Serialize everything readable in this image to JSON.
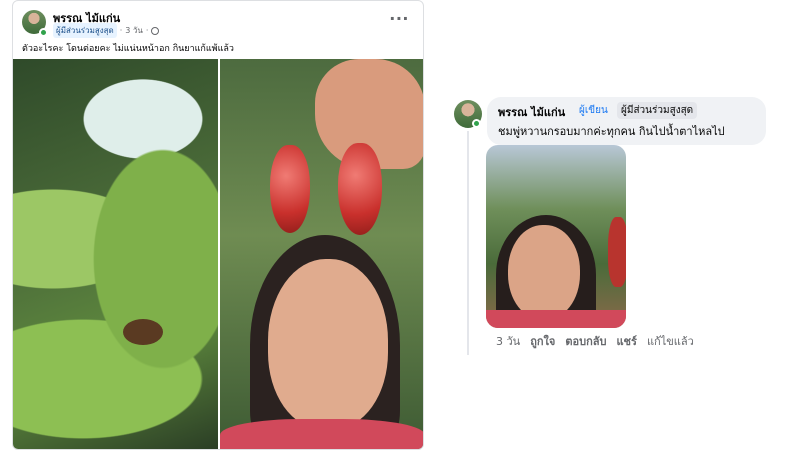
{
  "post": {
    "author": "พรรณ ไม้แก่น",
    "badge": "ผู้มีส่วนร่วมสูงสุด",
    "time": "3 วัน",
    "caption": "ตัวอะไรคะ โดนต่อยคะ ไม่แน่นหน้าอก กินยาแก้แพ้แล้ว"
  },
  "comment": {
    "author": "พรรณ ไม้แก่น",
    "role": "ผู้เขียน",
    "badge": "ผู้มีส่วนร่วมสูงสุด",
    "text": "ชมพู่หวานกรอบมากค่ะทุกคน กินไปน้ำตาไหลไป",
    "actions": {
      "time": "3 วัน",
      "like": "ถูกใจ",
      "reply": "ตอบกลับ",
      "share": "แชร์",
      "edited": "แก้ไขแล้ว"
    }
  },
  "colors": {
    "link_blue": "#1877f2",
    "online_green": "#31a24c",
    "bubble_bg": "#f0f2f5"
  },
  "icons": [
    "more-options-icon",
    "globe-icon",
    "online-status-icon"
  ]
}
